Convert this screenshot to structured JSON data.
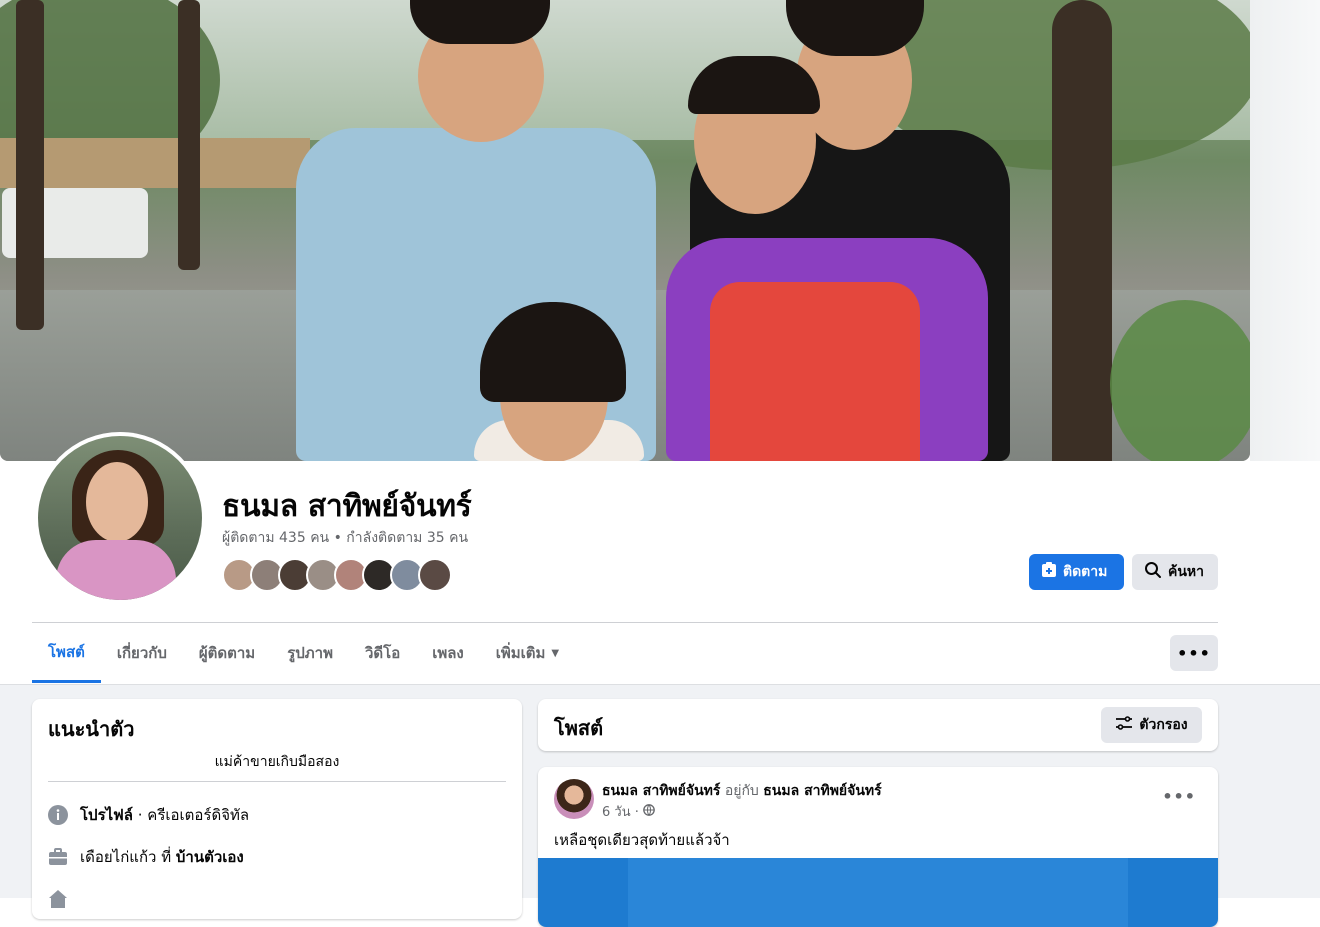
{
  "profile": {
    "name": "ธนมล สาทิพย์จันทร์",
    "stats": "ผู้ติดตาม 435 คน • กำลังติดตาม 35 คน"
  },
  "actions": {
    "follow_label": "ติดตาม",
    "search_label": "ค้นหา"
  },
  "tabs": [
    {
      "label": "โพสต์"
    },
    {
      "label": "เกี่ยวกับ"
    },
    {
      "label": "ผู้ติดตาม"
    },
    {
      "label": "รูปภาพ"
    },
    {
      "label": "วิดีโอ"
    },
    {
      "label": "เพลง"
    },
    {
      "label": "เพิ่มเติม"
    }
  ],
  "intro": {
    "title": "แนะนำตัว",
    "bio": "แม่ค้าขายเกิบมือสอง",
    "rows": [
      {
        "icon": "info-icon",
        "bold": "โปรไฟล์",
        "text": " · ครีเอเตอร์ดิจิทัล"
      },
      {
        "icon": "briefcase-icon",
        "text": "เดือยไก่แก้ว ที่ ",
        "bold": "บ้านตัวเอง"
      }
    ]
  },
  "posts_header": {
    "title": "โพสต์",
    "filter_label": "ตัวกรอง"
  },
  "post": {
    "author": "ธนมล สาทิพย์จันทร์",
    "with_text": " อยู่กับ ",
    "with_name": "ธนมล สาทิพย์จันทร์",
    "time": "6 วัน ·",
    "text": "เหลือชุดเดียวสุดท้ายแล้วจ้า"
  },
  "colors": {
    "accent": "#1b74e4",
    "button_gray": "#e4e6eb",
    "page_bg": "#f0f2f5",
    "secondary_text": "#65676b"
  }
}
